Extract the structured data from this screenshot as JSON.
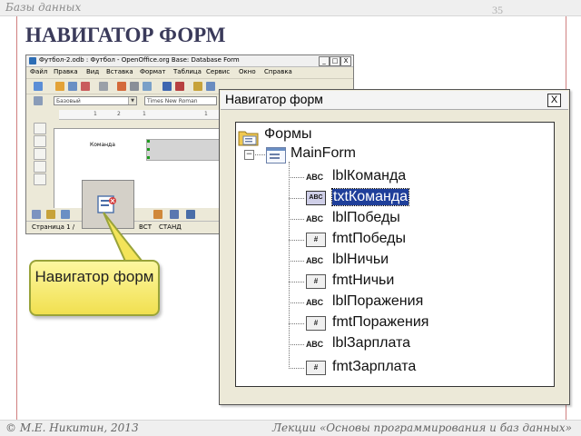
{
  "header": {
    "topic": "Базы данных",
    "page_number": "35"
  },
  "title": "НАВИГАТОР ФОРМ",
  "footer": {
    "left": "© М.Е. Никитин, 2013",
    "right": "Лекции «Основы программирования и баз данных»"
  },
  "oo_window": {
    "title": "Футбол-2.odb : Футбол - OpenOffice.org Base: Database Form",
    "window_buttons": [
      "_",
      "□",
      "X"
    ],
    "menu": [
      "Файл",
      "Правка",
      "Вид",
      "Вставка",
      "Формат",
      "Таблица",
      "Сервис",
      "Окно",
      "Справка"
    ],
    "style_combo": "Базовый",
    "font_combo": "Times New Roman",
    "ruler": [
      "1",
      "2",
      "1",
      "1"
    ],
    "field_label": "Команда",
    "status": {
      "page": "Страница 1 /",
      "mode1": "ВСТ",
      "mode2": "СТАНД"
    }
  },
  "callout": {
    "text": "Навигатор форм"
  },
  "navigator": {
    "title": "Навигатор форм",
    "close_symbol": "X",
    "root": "Формы",
    "form": "MainForm",
    "expander": "−",
    "items": [
      {
        "icon": "ABC",
        "kind": "label",
        "label": "lblКоманда",
        "selected": false
      },
      {
        "icon": "ABC",
        "kind": "text",
        "label": "txtКоманда",
        "selected": true
      },
      {
        "icon": "ABC",
        "kind": "label",
        "label": "lblПобеды",
        "selected": false
      },
      {
        "icon": "#",
        "kind": "format",
        "label": "fmtПобеды",
        "selected": false
      },
      {
        "icon": "ABC",
        "kind": "label",
        "label": "lblНичьи",
        "selected": false
      },
      {
        "icon": "#",
        "kind": "format",
        "label": "fmtНичьи",
        "selected": false
      },
      {
        "icon": "ABC",
        "kind": "label",
        "label": "lblПоражения",
        "selected": false
      },
      {
        "icon": "#",
        "kind": "format",
        "label": "fmtПоражения",
        "selected": false
      },
      {
        "icon": "ABC",
        "kind": "label",
        "label": "lblЗарплата",
        "selected": false
      },
      {
        "icon": "#",
        "kind": "format",
        "label": "fmtЗарплата",
        "selected": false
      }
    ]
  },
  "colors": {
    "title": "#3a3a5a",
    "frame": "#d08080",
    "selection": "#1f3f9a",
    "callout": "#f1e050"
  }
}
